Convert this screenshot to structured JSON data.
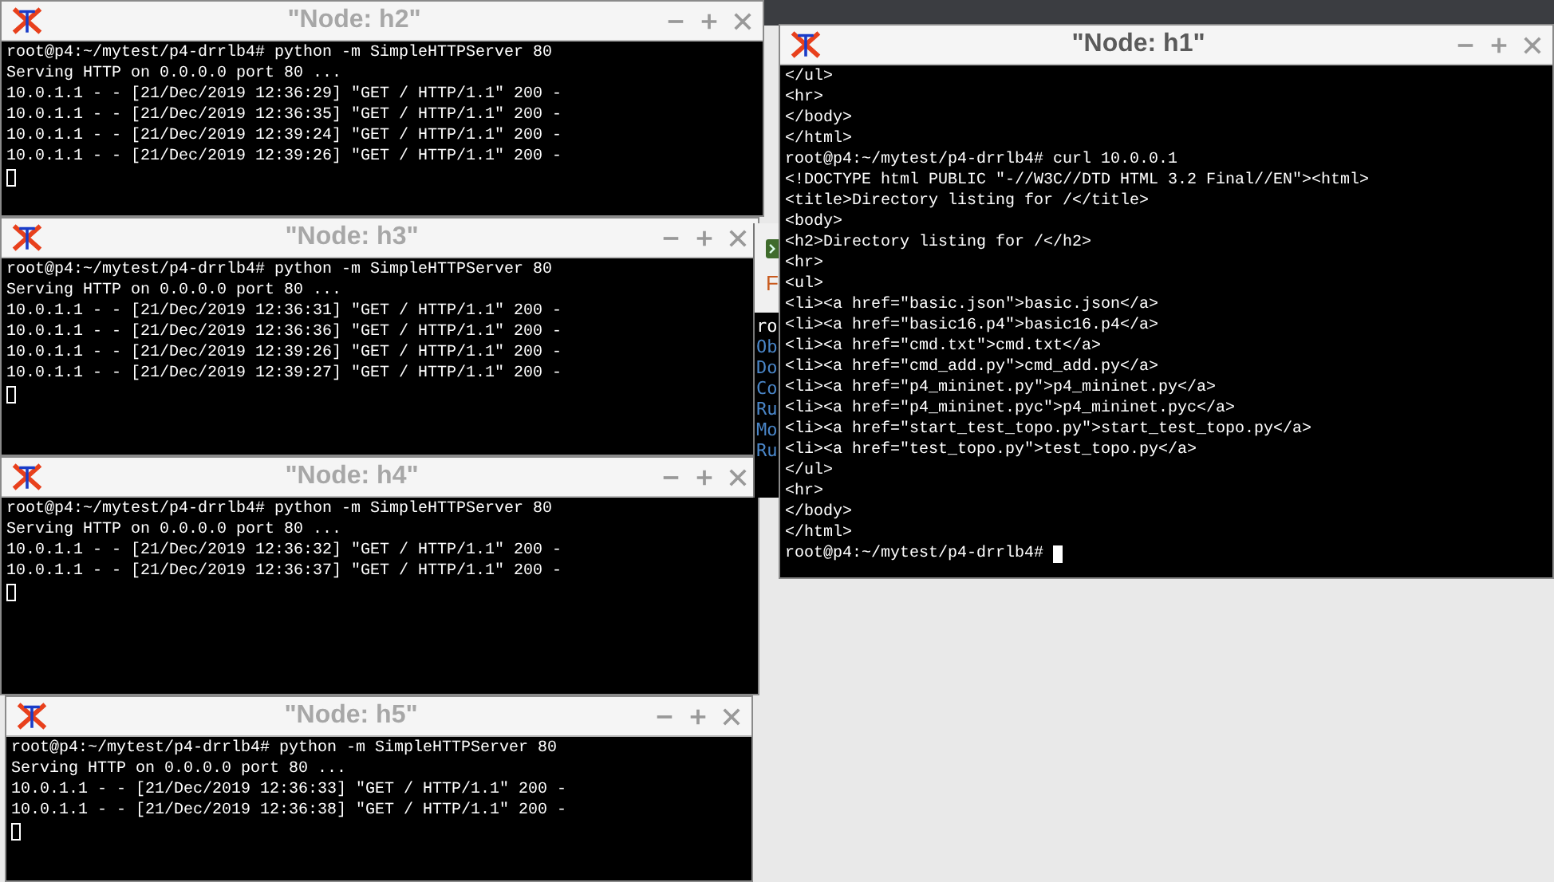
{
  "windows": [
    {
      "title": "\"Node: h2\"",
      "focused": false,
      "lines": [
        "root@p4:~/mytest/p4-drrlb4# python -m SimpleHTTPServer 80",
        "Serving HTTP on 0.0.0.0 port 80 ...",
        "10.0.1.1 - - [21/Dec/2019 12:36:29] \"GET / HTTP/1.1\" 200 -",
        "10.0.1.1 - - [21/Dec/2019 12:36:35] \"GET / HTTP/1.1\" 200 -",
        "10.0.1.1 - - [21/Dec/2019 12:39:24] \"GET / HTTP/1.1\" 200 -",
        "10.0.1.1 - - [21/Dec/2019 12:39:26] \"GET / HTTP/1.1\" 200 -"
      ]
    },
    {
      "title": "\"Node: h3\"",
      "focused": false,
      "lines": [
        "root@p4:~/mytest/p4-drrlb4# python -m SimpleHTTPServer 80",
        "Serving HTTP on 0.0.0.0 port 80 ...",
        "10.0.1.1 - - [21/Dec/2019 12:36:31] \"GET / HTTP/1.1\" 200 -",
        "10.0.1.1 - - [21/Dec/2019 12:36:36] \"GET / HTTP/1.1\" 200 -",
        "10.0.1.1 - - [21/Dec/2019 12:39:26] \"GET / HTTP/1.1\" 200 -",
        "10.0.1.1 - - [21/Dec/2019 12:39:27] \"GET / HTTP/1.1\" 200 -"
      ]
    },
    {
      "title": "\"Node: h4\"",
      "focused": false,
      "lines": [
        "root@p4:~/mytest/p4-drrlb4# python -m SimpleHTTPServer 80",
        "Serving HTTP on 0.0.0.0 port 80 ...",
        "10.0.1.1 - - [21/Dec/2019 12:36:32] \"GET / HTTP/1.1\" 200 -",
        "10.0.1.1 - - [21/Dec/2019 12:36:37] \"GET / HTTP/1.1\" 200 -"
      ]
    },
    {
      "title": "\"Node: h5\"",
      "focused": false,
      "lines": [
        "root@p4:~/mytest/p4-drrlb4# python -m SimpleHTTPServer 80",
        "Serving HTTP on 0.0.0.0 port 80 ...",
        "10.0.1.1 - - [21/Dec/2019 12:36:33] \"GET / HTTP/1.1\" 200 -",
        "10.0.1.1 - - [21/Dec/2019 12:36:38] \"GET / HTTP/1.1\" 200 -"
      ]
    },
    {
      "title": "\"Node: h1\"",
      "focused": true,
      "lines": [
        "</ul>",
        "<hr>",
        "</body>",
        "</html>",
        "root@p4:~/mytest/p4-drrlb4# curl 10.0.0.1",
        "<!DOCTYPE html PUBLIC \"-//W3C//DTD HTML 3.2 Final//EN\"><html>",
        "<title>Directory listing for /</title>",
        "<body>",
        "<h2>Directory listing for /</h2>",
        "<hr>",
        "<ul>",
        "<li><a href=\"basic.json\">basic.json</a>",
        "<li><a href=\"basic16.p4\">basic16.p4</a>",
        "<li><a href=\"cmd.txt\">cmd.txt</a>",
        "<li><a href=\"cmd_add.py\">cmd_add.py</a>",
        "<li><a href=\"p4_mininet.py\">p4_mininet.py</a>",
        "<li><a href=\"p4_mininet.pyc\">p4_mininet.pyc</a>",
        "<li><a href=\"start_test_topo.py\">start_test_topo.py</a>",
        "<li><a href=\"test_topo.py\">test_topo.py</a>",
        "</ul>",
        "<hr>",
        "</body>",
        "</html>",
        "root@p4:~/mytest/p4-drrlb4# "
      ]
    }
  ],
  "background_window": {
    "heading": "F",
    "lines": [
      "ro",
      "Ob",
      "Do",
      "Co",
      "Ru",
      "Mo",
      "Ru"
    ]
  }
}
